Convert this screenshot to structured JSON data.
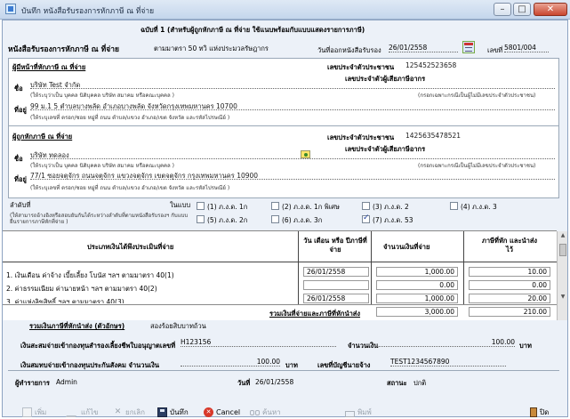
{
  "window": {
    "title": "บันทึก หนังสือรับรองการหักภาษี ณ ที่จ่าย"
  },
  "header": {
    "copy_line": "ฉบับที่ 1 (สำหรับผู้ถูกหักภาษี ณ ที่จ่าย ใช้แนบพร้อมกับแบบแสดงรายการภาษี)",
    "form_title": "หนังสือรับรองการหักภาษี ณ ที่จ่าย",
    "form_law": "ตามมาตรา 50 ทวิ แห่งประมวลรัษฎากร",
    "issue_date_label": "วันที่ออกหนังสือรับรอง",
    "issue_date": "26/01/2558",
    "number_label": "เลขที่",
    "number": "5801/004"
  },
  "payer": {
    "heading": "ผู้มีหน้าที่หักภาษี ณ ที่จ่าย",
    "tax_id_label": "เลขประจำตัวประชาชน",
    "tax_id": "125452523658",
    "taxpayer_id_label": "เลขประจำตัวผู้เสียภาษีอากร",
    "name_label": "ชื่อ",
    "name": "บริษัท Test จำกัด",
    "name_hint": "(ให้ระบุว่าเป็น บุคคล นิติบุคคล บริษัท สมาคม หรือคณะบุคคล )",
    "id_hint": "(กรอกเฉพาะกรณีเป็นผู้ไม่มีเลขประจำตัวประชาชน)",
    "address_label": "ที่อยู่",
    "address": "99 ม.1 5 ตำบลบางพลัด อำเภอบางพลัด จังหวัดกรุงเทพมหานคร 10700",
    "address_hint": "(ให้ระบุเลขที่ ตรอก/ซอย หมู่ที่ ถนน ตำบล/แขวง อำเภอ/เขต จังหวัด และรหัสไปรษณีย์ )"
  },
  "payee": {
    "heading": "ผู้ถูกหักภาษี ณ ที่จ่าย",
    "tax_id_label": "เลขประจำตัวประชาชน",
    "tax_id": "1425635478521",
    "taxpayer_id_label": "เลขประจำตัวผู้เสียภาษีอากร",
    "name_label": "ชื่อ",
    "name": "บริษัท ทดลอง",
    "name_hint": "(ให้ระบุว่าเป็น บุคคล นิติบุคคล บริษัท สมาคม หรือคณะบุคคล )",
    "id_hint": "(กรอกเฉพาะกรณีเป็นผู้ไม่มีเลขประจำตัวประชาชน)",
    "address_label": "ที่อยู่",
    "address": "77/1 ซอยจตุจักร ถนนจตุจักร แขวงจตุจักร เขตจตุจักร กรุงเทพมหานคร 10900",
    "address_hint": "(ให้ระบุเลขที่ ตรอก/ซอย หมู่ที่ ถนน ตำบล/แขวง อำเภอ/เขต จังหวัด และรหัสไปรษณีย์ )"
  },
  "form_type": {
    "seq_label": "ลำดับที่",
    "in_form_label": "ในแบบ",
    "hint": "(ให้สามารถอ้างอิงหรือสอบยันกันได้ระหว่างลำดับที่ตามหนังสือรับรองฯ กับแบบยื่นรายการภาษีหักที่จ่าย )",
    "options": [
      {
        "label": "(1) ภ.ง.ด. 1ก",
        "checked": false
      },
      {
        "label": "(2) ภ.ง.ด. 1ก พิเศษ",
        "checked": false
      },
      {
        "label": "(3) ภ.ง.ด. 2",
        "checked": false
      },
      {
        "label": "(4) ภ.ง.ด. 3",
        "checked": false
      },
      {
        "label": "(5) ภ.ง.ด. 2ก",
        "checked": false
      },
      {
        "label": "(6) ภ.ง.ด. 3ก",
        "checked": false
      },
      {
        "label": "(7) ภ.ง.ด. 53",
        "checked": true
      }
    ]
  },
  "income": {
    "col_type": "ประเภทเงินได้พึงประเมินที่จ่าย",
    "col_date": "วัน เดือน หรือ ปีภาษีที่จ่าย",
    "col_amount": "จำนวนเงินที่จ่าย",
    "col_tax": "ภาษีที่หัก และนำส่งไว้",
    "rows": [
      {
        "type": "1. เงินเดือน ค่าจ้าง เบี้ยเลี้ยง โบนัส ฯลฯ ตามมาตรา 40(1)",
        "date": "26/01/2558",
        "amount": "1,000.00",
        "tax": "10.00"
      },
      {
        "type": "2. ค่าธรรมเนียม ค่านายหน้า ฯลฯ ตามมาตรา 40(2)",
        "date": "",
        "amount": "0.00",
        "tax": "0.00"
      },
      {
        "type": "3. ค่าแห่งลิขสิทธิ์ ฯลฯ ตามมาตรา 40(3)",
        "date": "26/01/2558",
        "amount": "1,000.00",
        "tax": "20.00"
      }
    ],
    "total_label": "รวมเงินที่จ่ายและภาษีที่หักนำส่ง",
    "total_amount": "3,000.00",
    "total_tax": "210.00"
  },
  "summary": {
    "tax_text_label": "รวมเงินภาษีที่หักนำส่ง (ตัวอักษร)",
    "tax_text": "สองร้อยสิบบาทถ้วน",
    "fund_label": "เงินสะสมจ่ายเข้ากองทุนสำรองเลี้ยงชีพใบอนุญาตเลขที่",
    "fund_no": "H123156",
    "fund_amount_label": "จำนวนเงิน",
    "fund_amount": "100.00",
    "baht": "บาท",
    "sso_label": "เงินสมทบจ่ายเข้ากองทุนประกันสังคม จำนวนเงิน",
    "sso_amount": "100.00",
    "employer_label": "เลขที่บัญชีนายจ้าง",
    "employer_no": "TEST1234567890",
    "recorder_label": "ผู้ทำรายการ",
    "recorder": "Admin",
    "date_label": "วันที่",
    "date": "26/01/2558",
    "status_label": "สถานะ",
    "status": "ปกติ"
  },
  "toolbar": {
    "add": "เพิ่ม",
    "edit": "แก้ไข",
    "cancel_doc": "ยกเลิก",
    "save": "บันทึก",
    "cancel": "Cancel",
    "search": "ค้นหา",
    "print": "พิมพ์",
    "close": "ปิด"
  }
}
